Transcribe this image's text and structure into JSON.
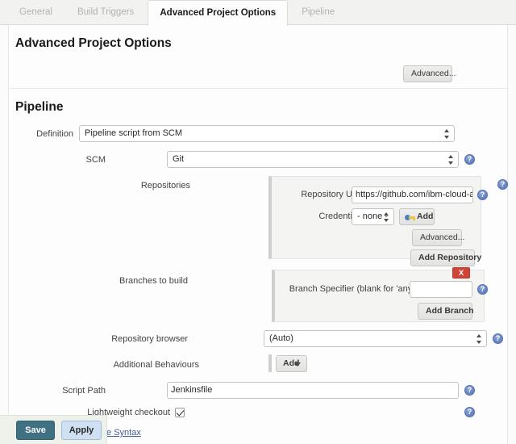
{
  "tabs": [
    {
      "label": "General",
      "active": false
    },
    {
      "label": "Build Triggers",
      "active": false
    },
    {
      "label": "Advanced Project Options",
      "active": true
    },
    {
      "label": "Pipeline",
      "active": false
    }
  ],
  "advanced_section": {
    "heading": "Advanced Project Options",
    "advanced_button": "Advanced..."
  },
  "pipeline_section": {
    "heading": "Pipeline",
    "definition": {
      "label": "Definition",
      "value": "Pipeline script from SCM"
    },
    "scm": {
      "label": "SCM",
      "value": "Git"
    },
    "repositories": {
      "label": "Repositories",
      "repository_url": {
        "label": "Repository URL",
        "value": "https://github.com/ibm-cloud-archit"
      },
      "credentials": {
        "label": "Credentials",
        "value": "- none -",
        "add_button": "Add"
      },
      "advanced_button": "Advanced...",
      "add_repository_button": "Add Repository"
    },
    "branches": {
      "label": "Branches to build",
      "delete_button": "X",
      "branch_specifier": {
        "label": "Branch Specifier (blank for 'any')",
        "value": ""
      },
      "add_branch_button": "Add Branch"
    },
    "repository_browser": {
      "label": "Repository browser",
      "value": "(Auto)"
    },
    "additional_behaviours": {
      "label": "Additional Behaviours",
      "add_button": "Add"
    },
    "script_path": {
      "label": "Script Path",
      "value": "Jenkinsfile"
    },
    "lightweight_checkout": {
      "label": "Lightweight checkout",
      "checked": true
    },
    "pipeline_syntax_link": "Pipeline Syntax"
  },
  "savebar": {
    "save_label": "Save",
    "apply_label": "Apply"
  },
  "colors": {
    "accent_save": "#3f7183",
    "accent_apply": "#cfe0f2",
    "danger": "#cf4436",
    "help_blue": "#5b79b8",
    "link": "#3f5f9a"
  }
}
